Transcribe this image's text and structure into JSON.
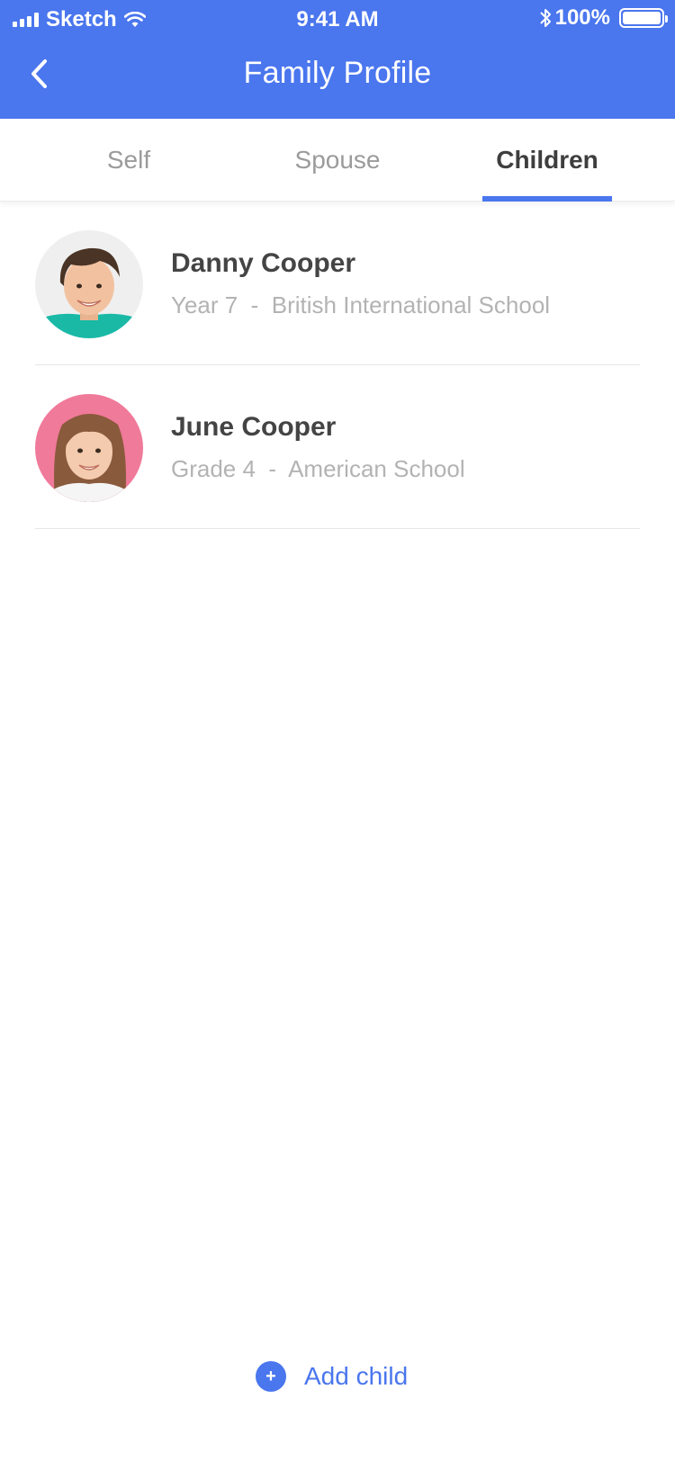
{
  "status_bar": {
    "carrier": "Sketch",
    "time": "9:41 AM",
    "battery": "100%"
  },
  "header": {
    "title": "Family Profile",
    "back_icon": "chevron-left-icon"
  },
  "tabs": [
    {
      "label": "Self",
      "active": false
    },
    {
      "label": "Spouse",
      "active": false
    },
    {
      "label": "Children",
      "active": true
    }
  ],
  "children": [
    {
      "name": "Danny Cooper",
      "detail": "Year 7  -  British International School",
      "avatar": "boy-photo"
    },
    {
      "name": "June Cooper",
      "detail": "Grade 4  -  American School",
      "avatar": "girl-photo"
    }
  ],
  "add_child": {
    "label": "Add child",
    "icon": "plus-icon",
    "icon_glyph": "+"
  },
  "colors": {
    "accent": "#4A76EE",
    "name_text": "#444444",
    "detail_text": "#B3B3B3",
    "inactive_tab": "#9B9B9B"
  }
}
